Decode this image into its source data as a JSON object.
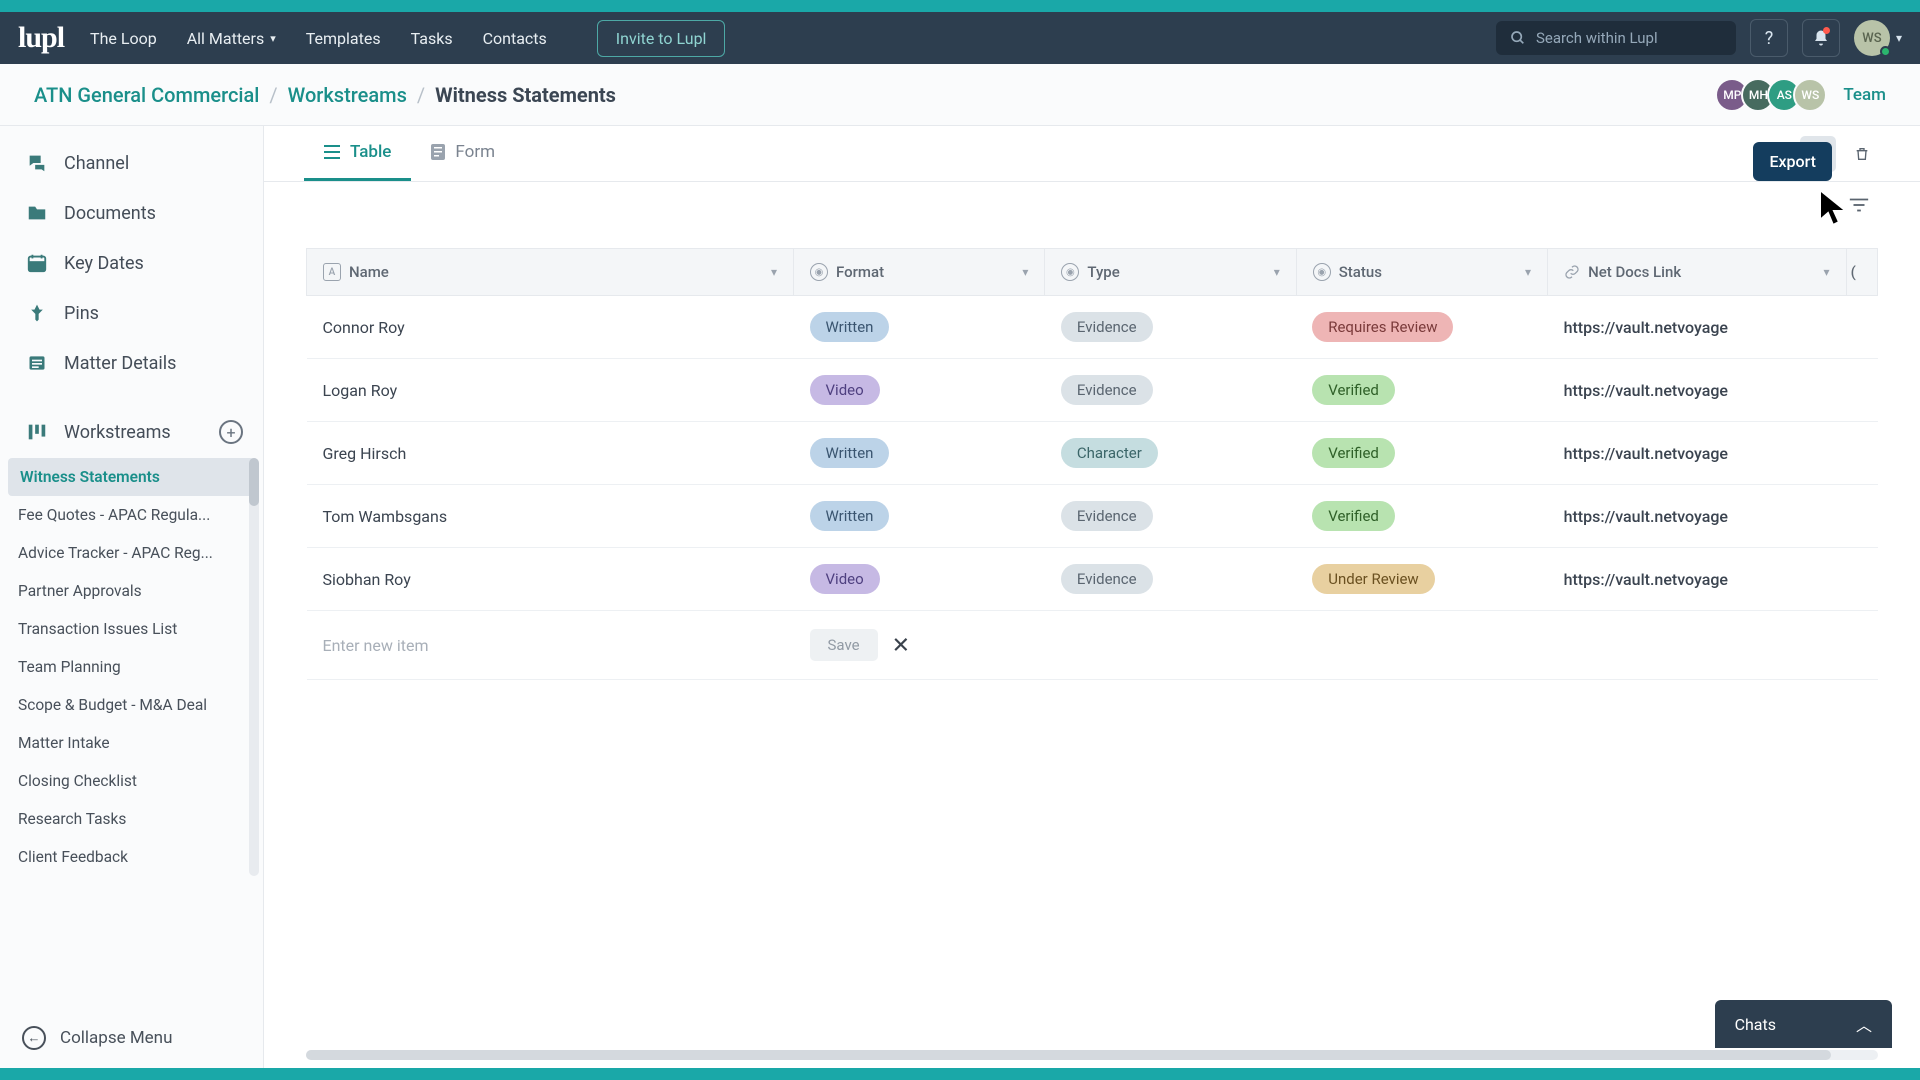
{
  "header": {
    "logo": "lupl",
    "nav": [
      "The Loop",
      "All Matters",
      "Templates",
      "Tasks",
      "Contacts"
    ],
    "invite": "Invite to Lupl",
    "search_placeholder": "Search within Lupl",
    "avatar_initials": "WS"
  },
  "breadcrumb": {
    "root": "ATN General Commercial",
    "mid": "Workstreams",
    "current": "Witness Statements",
    "avatars": [
      "MP",
      "MH",
      "AS",
      "WS"
    ],
    "team": "Team"
  },
  "tooltip_export": "Export",
  "sidebar": {
    "items": [
      {
        "icon": "chat",
        "label": "Channel"
      },
      {
        "icon": "folder",
        "label": "Documents"
      },
      {
        "icon": "calendar",
        "label": "Key Dates"
      },
      {
        "icon": "pin",
        "label": "Pins"
      },
      {
        "icon": "list",
        "label": "Matter Details"
      }
    ],
    "workstreams_label": "Workstreams",
    "workstreams": [
      "Witness Statements",
      "Fee Quotes - APAC Regula...",
      "Advice Tracker - APAC Reg...",
      "Partner Approvals",
      "Transaction Issues List",
      "Team Planning",
      "Scope & Budget - M&A Deal",
      "Matter Intake",
      "Closing Checklist",
      "Research Tasks",
      "Client Feedback"
    ],
    "collapse": "Collapse Menu"
  },
  "tabs": {
    "table": "Table",
    "form": "Form"
  },
  "table": {
    "columns": [
      "Name",
      "Format",
      "Type",
      "Status",
      "Net Docs Link"
    ],
    "rows": [
      {
        "name": "Connor Roy",
        "format": "Written",
        "type": "Evidence",
        "status": "Requires Review",
        "link": "https://vault.netvoyage"
      },
      {
        "name": "Logan Roy",
        "format": "Video",
        "type": "Evidence",
        "status": "Verified",
        "link": "https://vault.netvoyage"
      },
      {
        "name": "Greg Hirsch",
        "format": "Written",
        "type": "Character",
        "status": "Verified",
        "link": "https://vault.netvoyage"
      },
      {
        "name": "Tom Wambsgans",
        "format": "Written",
        "type": "Evidence",
        "status": "Verified",
        "link": "https://vault.netvoyage"
      },
      {
        "name": "Siobhan Roy",
        "format": "Video",
        "type": "Evidence",
        "status": "Under Review",
        "link": "https://vault.netvoyage"
      }
    ],
    "new_placeholder": "Enter new item",
    "save": "Save"
  },
  "chats": "Chats",
  "pill_class": {
    "Written": "written",
    "Video": "video",
    "Evidence": "evidence",
    "Character": "character",
    "Requires Review": "requires",
    "Verified": "verified",
    "Under Review": "under"
  }
}
